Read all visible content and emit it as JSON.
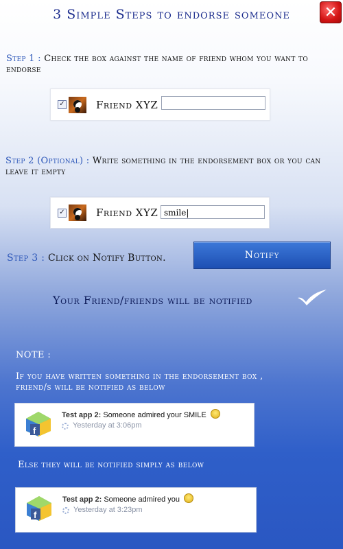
{
  "title": "3 Simple Steps to endorse someone",
  "close_icon": "close-icon",
  "step1": {
    "label": "Step 1 :",
    "text": "Check the box against the name of friend whom you want to endorse",
    "friend": {
      "checked": true,
      "name": "Friend XYZ",
      "input_value": ""
    }
  },
  "step2": {
    "label": "Step 2 (Optional) :",
    "text": "Write something in the endorsement box or you can leave it empty",
    "friend": {
      "checked": true,
      "name": "Friend XYZ",
      "input_value": "smile"
    }
  },
  "step3": {
    "label": "Step 3 :",
    "text": "Click on Notify Button.",
    "button": "Notify"
  },
  "notified_message": "Your Friend/friends will be notified",
  "note": {
    "heading": "NOTE :",
    "line1": "If you have written something in the endorsement box ,",
    "line2": "friend/s will be notified as below",
    "else_text": "Else they will be notified simply as below"
  },
  "notifications": [
    {
      "app": "Test app 2:",
      "message": "Someone admired your SMILE",
      "time": "Yesterday at 3:06pm"
    },
    {
      "app": "Test app 2:",
      "message": "Someone admired you",
      "time": "Yesterday at 3:23pm"
    }
  ],
  "colors": {
    "accent_blue": "#2a55b8",
    "title_blue": "#1a2b8c",
    "button_blue": "#1d4fb3",
    "close_red": "#d31414"
  }
}
